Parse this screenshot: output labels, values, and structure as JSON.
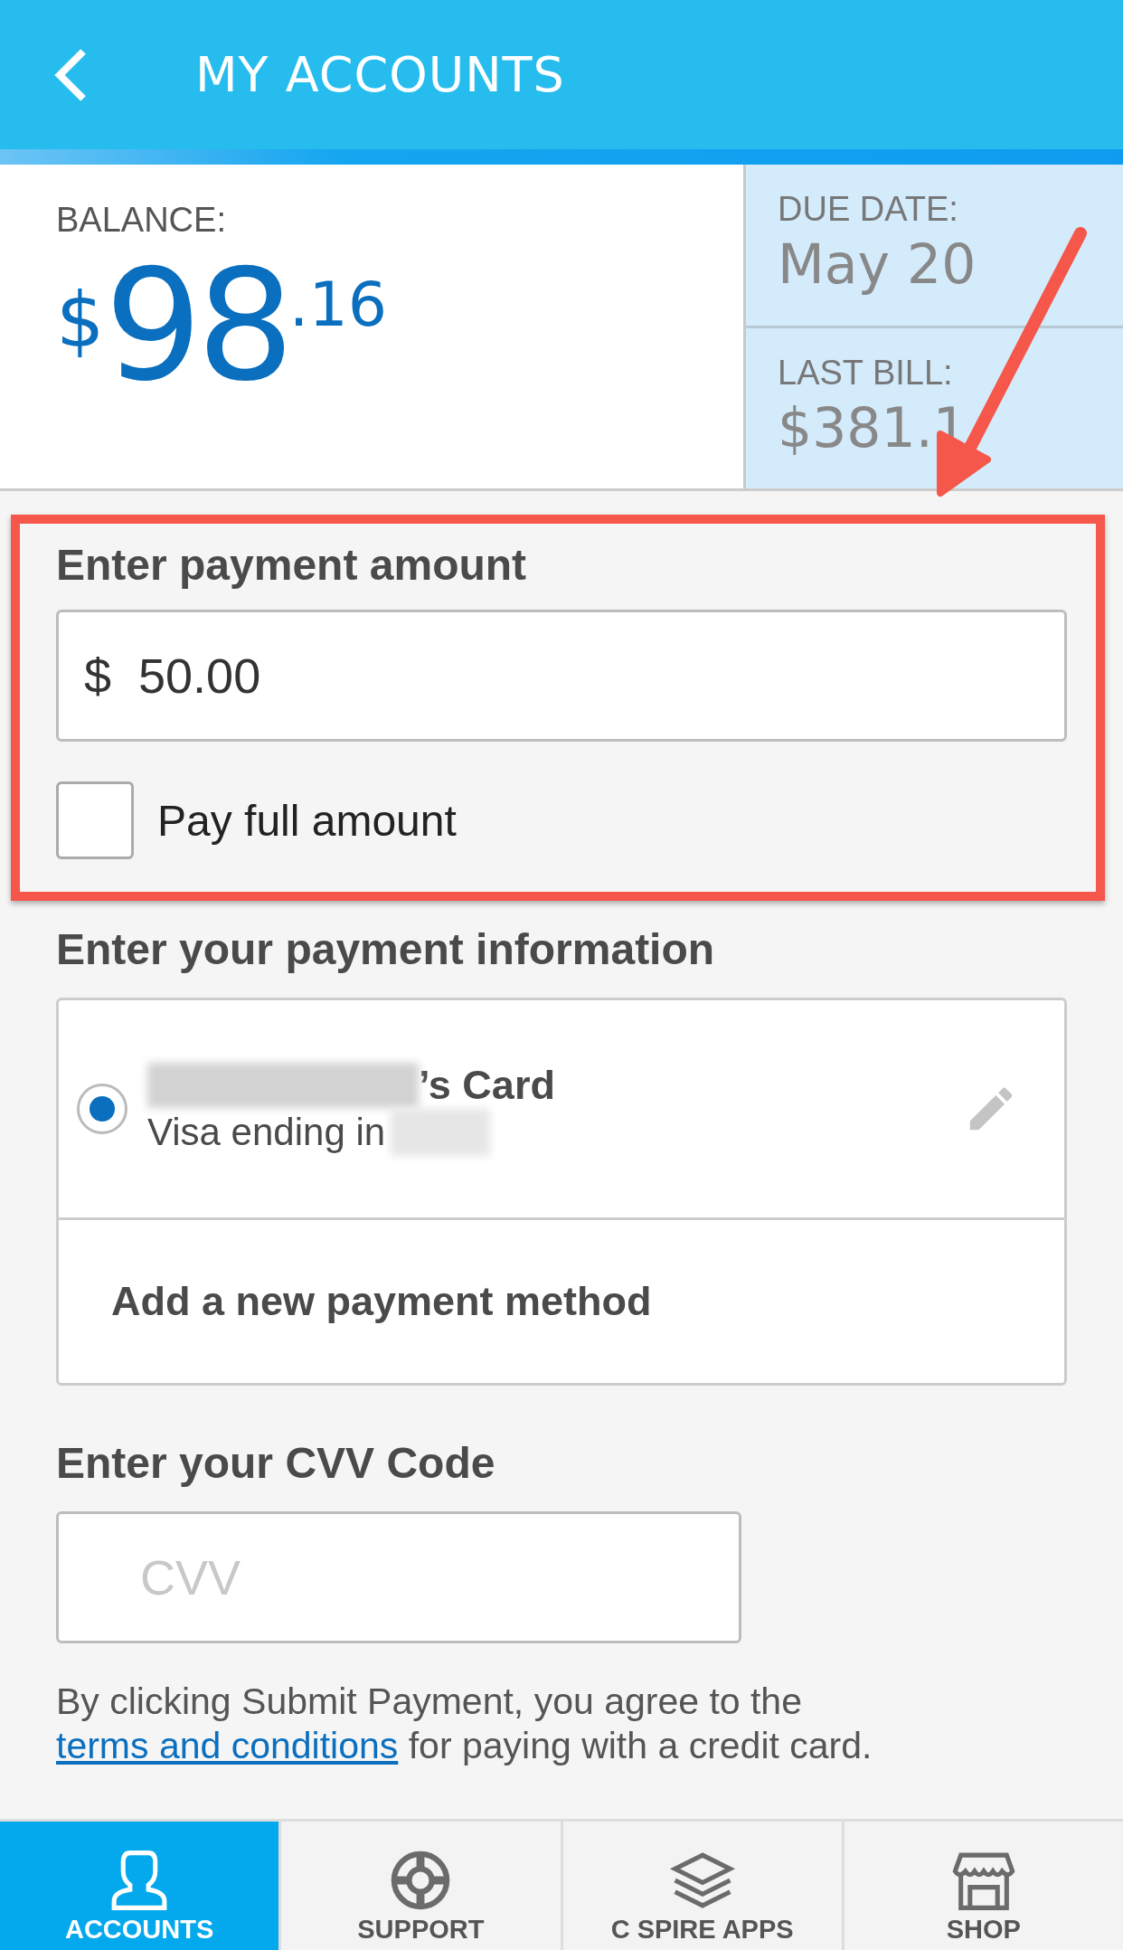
{
  "header": {
    "title": "MY ACCOUNTS"
  },
  "balance": {
    "label": "BALANCE:",
    "currency": "$",
    "whole": "98",
    "cents": ".16"
  },
  "summary": [
    {
      "label": "DUE DATE:",
      "value": "May 20"
    },
    {
      "label": "LAST BILL:",
      "value": "$381.1"
    }
  ],
  "payment_amount": {
    "heading": "Enter payment amount",
    "currency": "$",
    "value": "50.00",
    "pay_full": {
      "label": "Pay full amount",
      "checked": false
    },
    "highlighted": true
  },
  "payment_info": {
    "heading": "Enter your payment information",
    "methods": [
      {
        "kind": "card",
        "title": "’s Card",
        "subtitle": "Visa ending in",
        "selected": true
      },
      {
        "kind": "add",
        "title": "Add a new payment method"
      }
    ]
  },
  "cvv": {
    "heading": "Enter your CVV Code",
    "placeholder": "CVV"
  },
  "terms": {
    "before": "By clicking Submit Payment, you agree to the ",
    "link": "terms and conditions",
    "after": " for paying with a credit card."
  },
  "nav": [
    {
      "kind": "person",
      "label": "ACCOUNTS",
      "selected": true
    },
    {
      "kind": "lifebuoy",
      "label": "SUPPORT",
      "selected": false
    },
    {
      "kind": "layers",
      "label": "C SPIRE APPS",
      "selected": false
    },
    {
      "kind": "store",
      "label": "SHOP",
      "selected": false
    }
  ]
}
